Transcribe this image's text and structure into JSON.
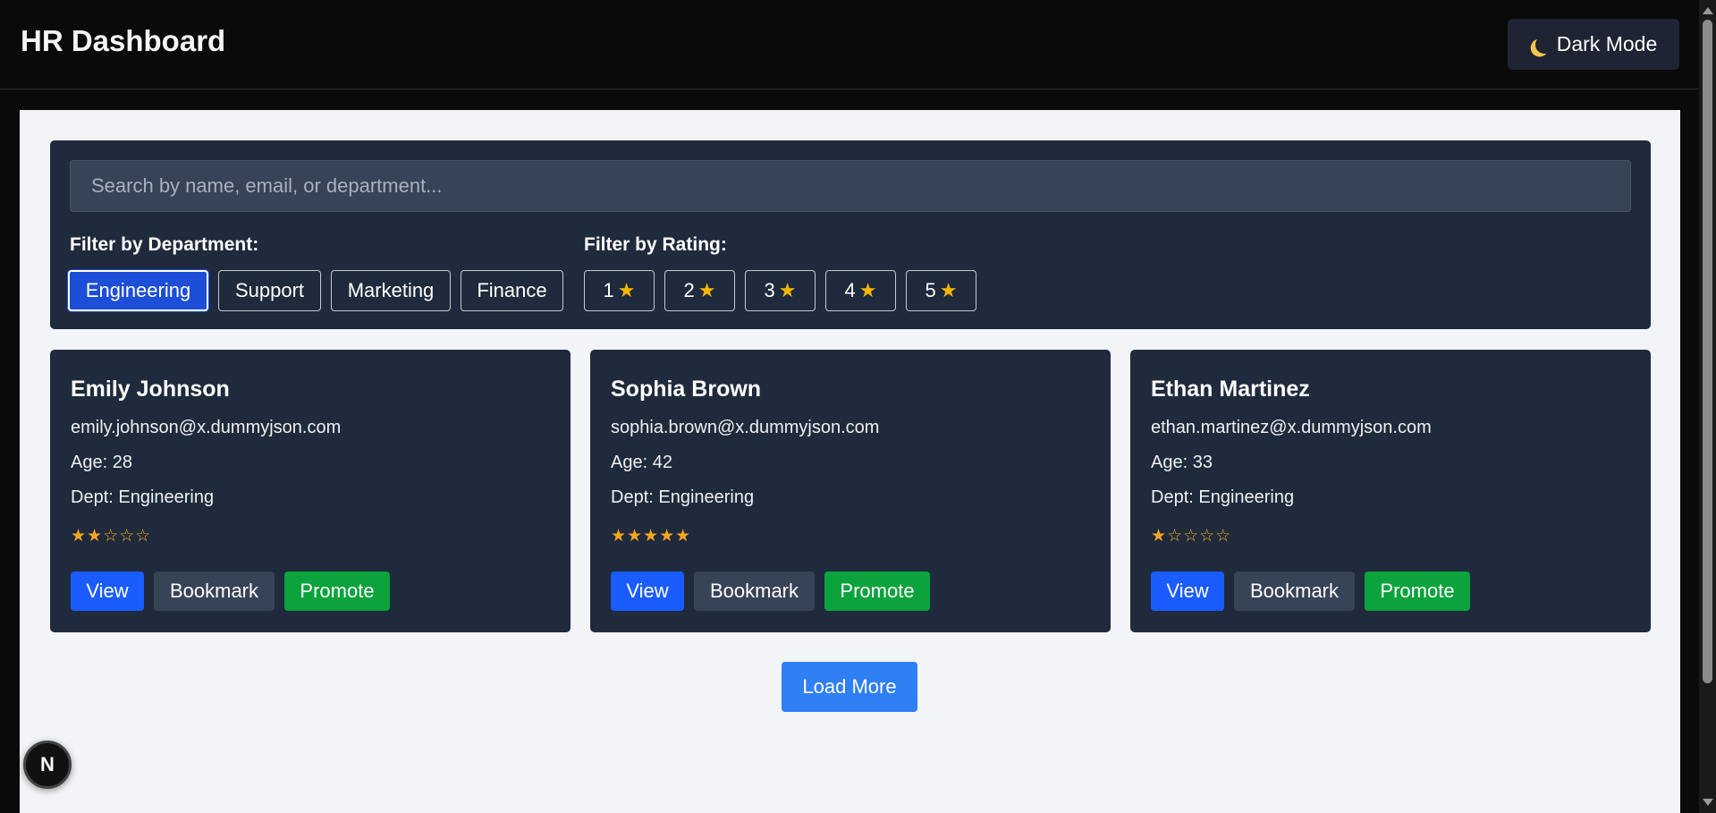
{
  "header": {
    "title": "HR Dashboard",
    "theme_button_label": "Dark Mode"
  },
  "filters": {
    "search_placeholder": "Search by name, email, or department...",
    "department_label": "Filter by Department:",
    "departments": [
      {
        "label": "Engineering",
        "active": true
      },
      {
        "label": "Support",
        "active": false
      },
      {
        "label": "Marketing",
        "active": false
      },
      {
        "label": "Finance",
        "active": false
      }
    ],
    "rating_label": "Filter by Rating:",
    "ratings": [
      "1",
      "2",
      "3",
      "4",
      "5"
    ]
  },
  "employees": [
    {
      "name": "Emily Johnson",
      "email": "emily.johnson@x.dummyjson.com",
      "age": "Age: 28",
      "dept": "Dept: Engineering",
      "rating": 2,
      "stars": "★★☆☆☆"
    },
    {
      "name": "Sophia Brown",
      "email": "sophia.brown@x.dummyjson.com",
      "age": "Age: 42",
      "dept": "Dept: Engineering",
      "rating": 5,
      "stars": "★★★★★"
    },
    {
      "name": "Ethan Martinez",
      "email": "ethan.martinez@x.dummyjson.com",
      "age": "Age: 33",
      "dept": "Dept: Engineering",
      "rating": 1,
      "stars": "★☆☆☆☆"
    }
  ],
  "card_actions": {
    "view": "View",
    "bookmark": "Bookmark",
    "promote": "Promote"
  },
  "load_more_label": "Load More",
  "floating_badge": "N",
  "colors": {
    "header_bg": "#0a0a0a",
    "panel_bg": "#1f2a3c",
    "main_bg": "#f2f4f7",
    "active_chip": "#1d4ed8",
    "view_btn": "#1a5cff",
    "bookmark_btn": "#374357",
    "promote_btn": "#0aa33c",
    "load_more_btn": "#2f7ff5",
    "star": "#f5a623"
  }
}
